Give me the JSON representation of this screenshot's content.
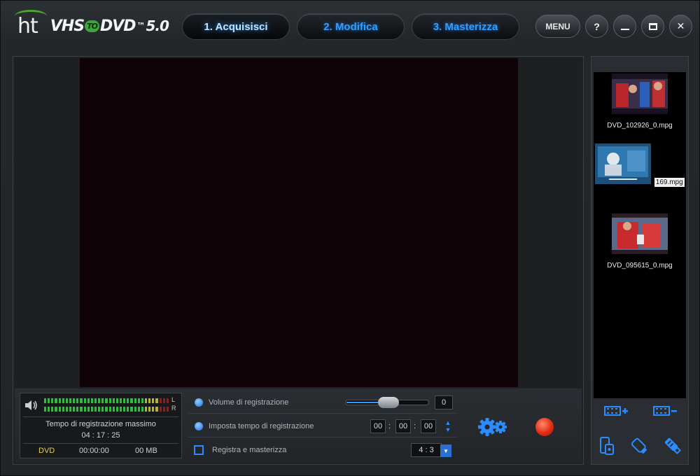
{
  "app": {
    "logo_ht": "ht",
    "logo_vhs": "VHS",
    "logo_to": "TO",
    "logo_dvd": "DVD",
    "logo_version": "5.0"
  },
  "tabs": [
    {
      "label": "1. Acquisisci",
      "active": true
    },
    {
      "label": "2. Modifica",
      "active": false
    },
    {
      "label": "3. Masterizza",
      "active": false
    }
  ],
  "window_controls": {
    "menu_label": "MENU",
    "help_label": "?",
    "minimize_label": "_",
    "maximize_label": "▭",
    "close_label": "✕"
  },
  "meter": {
    "left_label": "L",
    "right_label": "R",
    "max_time_label": "Tempo di registrazione massimo",
    "max_time_value": "04 : 17 : 25",
    "format": "DVD",
    "elapsed": "00:00:00",
    "size": "00 MB"
  },
  "options": {
    "volume_label": "Volume di registrazione",
    "volume_value": "0",
    "volume_level_fraction": 0.42,
    "set_time_label": "Imposta tempo di registrazione",
    "time_hh": "00",
    "time_mm": "00",
    "time_ss": "00",
    "record_burn_label": "Registra e masterizza",
    "aspect_value": "4 : 3"
  },
  "files": [
    {
      "name": "DVD_102926_0.mpg",
      "selected": false
    },
    {
      "name": "169.mpg",
      "selected": true
    },
    {
      "name": "DVD_095615_0.mpg",
      "selected": false
    }
  ],
  "colors": {
    "accent": "#2b8cff",
    "record": "#e22c12",
    "video_bg": "#100308"
  }
}
